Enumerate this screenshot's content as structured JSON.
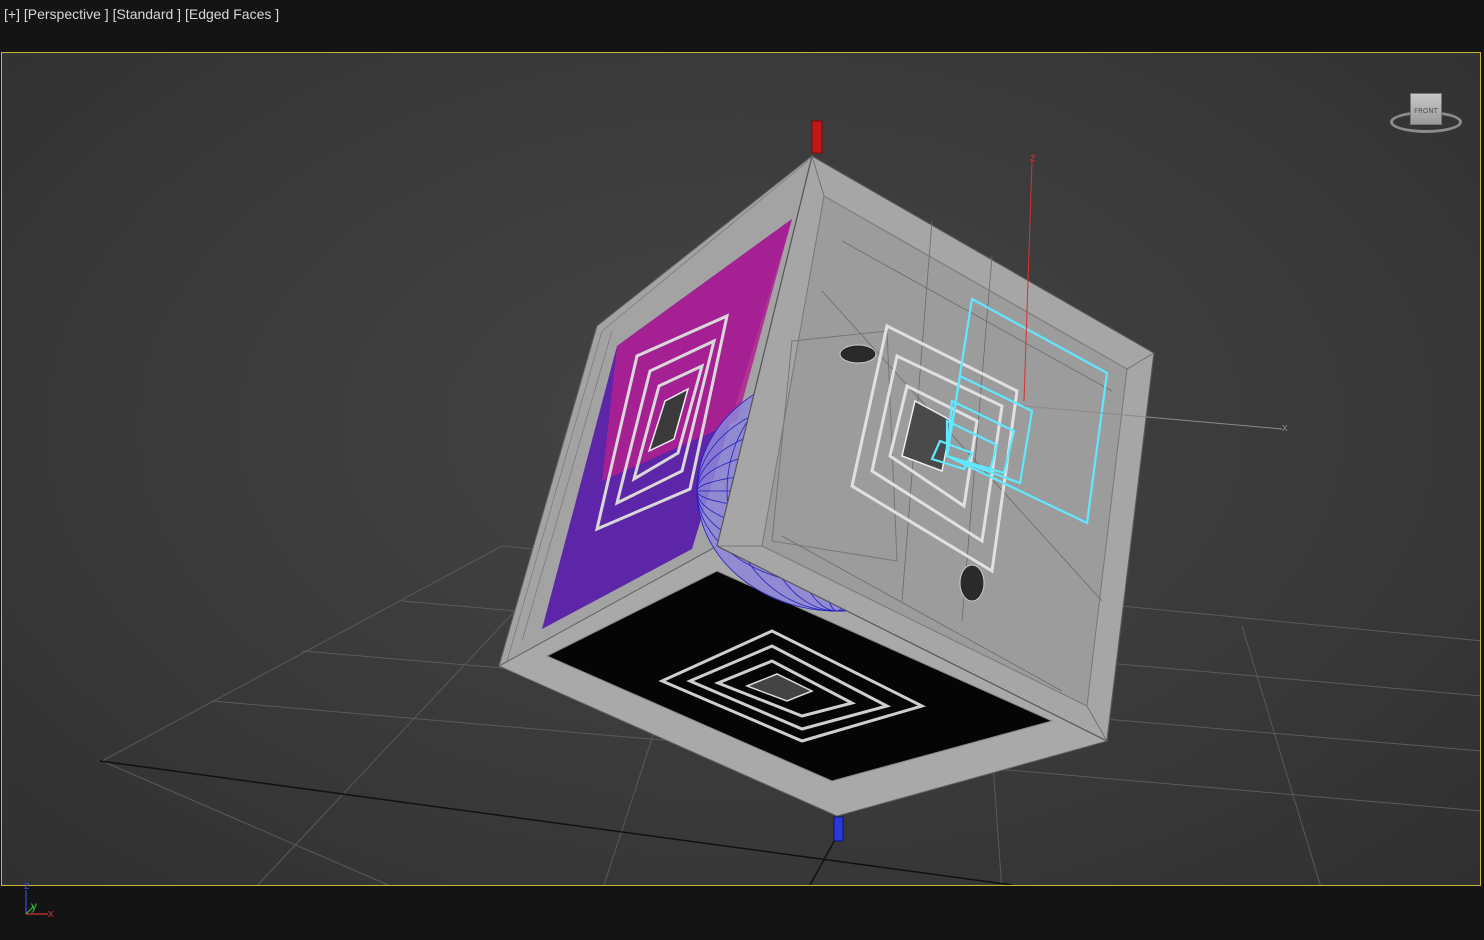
{
  "viewport_label": {
    "menu": "[+]",
    "view": "[Perspective ]",
    "shading": "[Standard ]",
    "edges": "[Edged Faces ]"
  },
  "viewcube": {
    "face_label": "FRONT"
  },
  "gizmo": {
    "z_label": "z",
    "x_label": "x"
  },
  "axis_tripod": {
    "z": "z",
    "y": "y",
    "x": "x"
  },
  "colors": {
    "viewport_border": "#c9b33a",
    "selection": "#5fe8ff",
    "x_axis": "#d83030",
    "y_axis": "#30c030",
    "z_axis": "#3040d8",
    "left_face_magenta": "#b0208f",
    "left_face_purple": "#5a1fa8",
    "sphere_wire": "#2020c0"
  }
}
